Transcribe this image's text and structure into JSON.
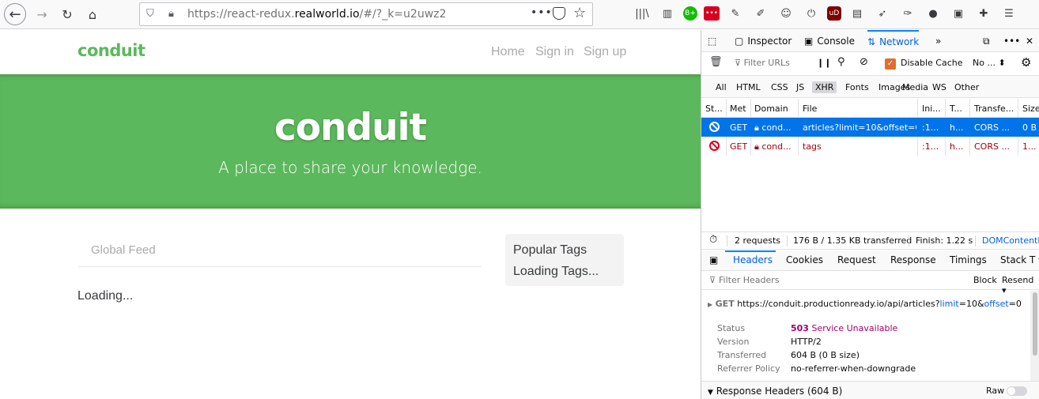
{
  "browser": {
    "url_prefix": "https://react-redux.",
    "url_domain": "realworld.io",
    "url_suffix": "/#/?_k=u2uwz2",
    "more_icon": "more-icon",
    "star_icon": "star-icon"
  },
  "extensions": [
    {
      "name": "library-icon",
      "glyph": "|||\\"
    },
    {
      "name": "sidebar-icon",
      "glyph": "▥"
    },
    {
      "name": "bplus-extension-icon",
      "glyph": "B+"
    },
    {
      "name": "dotdotdot-extension-icon",
      "glyph": "•••"
    },
    {
      "name": "eyedropper-icon",
      "glyph": "✎"
    },
    {
      "name": "paint-icon",
      "glyph": "✐"
    },
    {
      "name": "monkey-icon",
      "glyph": "☺"
    },
    {
      "name": "power-icon",
      "glyph": "⏻"
    },
    {
      "name": "ublock-icon",
      "glyph": "uD"
    },
    {
      "name": "news-icon",
      "glyph": "▤"
    },
    {
      "name": "rocket-icon",
      "glyph": "➶"
    },
    {
      "name": "pdf-icon",
      "glyph": "✑"
    },
    {
      "name": "group-icon",
      "glyph": "●"
    },
    {
      "name": "doc-icon",
      "glyph": "▣"
    },
    {
      "name": "puzzle-icon",
      "glyph": "✚"
    },
    {
      "name": "menu-icon",
      "glyph": "☰"
    }
  ],
  "site": {
    "brand": "conduit",
    "nav": {
      "home": "Home",
      "signin": "Sign in",
      "signup": "Sign up"
    },
    "banner_title": "conduit",
    "banner_sub": "A place to share your knowledge.",
    "feed_tab": "Global Feed",
    "loading": "Loading...",
    "sidebar_title": "Popular Tags",
    "sidebar_loading": "Loading Tags..."
  },
  "devtools": {
    "tabs": {
      "inspector": "Inspector",
      "console": "Console",
      "network": "Network"
    },
    "filter_placeholder": "Filter URLs",
    "disable_cache": "Disable Cache",
    "throttle": "No ...",
    "types": [
      "All",
      "HTML",
      "CSS",
      "JS",
      "XHR",
      "Fonts",
      "Images",
      "Media",
      "WS",
      "Other"
    ],
    "selected_type": "XHR",
    "columns": [
      "St...",
      "Met",
      "Domain",
      "File",
      "Ini...",
      "T...",
      "Transfe...",
      "Size"
    ],
    "rows": [
      {
        "method": "GET",
        "domain": "cond...",
        "file": "articles?limit=10&offset=0",
        "initiator": ":1...",
        "type": "h...",
        "transferred": "CORS ...",
        "size": "0 B"
      },
      {
        "method": "GET",
        "domain": "cond...",
        "file": "tags",
        "initiator": ":1...",
        "type": "h...",
        "transferred": "CORS ...",
        "size": "1..."
      }
    ],
    "status": {
      "requests": "2 requests",
      "transferred": "176 B / 1.35 KB transferred",
      "finish": "Finish: 1.22 s",
      "dom": "DOMContentL"
    },
    "detail_tabs": [
      "Headers",
      "Cookies",
      "Request",
      "Response",
      "Timings",
      "Stack T"
    ],
    "header_filter": "Filter Headers",
    "block": "Block",
    "resend": "Resend",
    "request_method": "GET",
    "request_url": "https://conduit.productionready.io/api/articles?",
    "request_q1": "limit",
    "request_v1": "=10&",
    "request_q2": "offset",
    "request_v2": "=0",
    "summary": {
      "status_label": "Status",
      "status_code": "503",
      "status_text": "Service Unavailable",
      "version_label": "Version",
      "version": "HTTP/2",
      "transferred_label": "Transferred",
      "transferred": "604 B (0 B size)",
      "referrer_label": "Referrer Policy",
      "referrer": "no-referrer-when-downgrade"
    },
    "response_headers": "Response Headers (604 B)",
    "raw": "Raw"
  }
}
